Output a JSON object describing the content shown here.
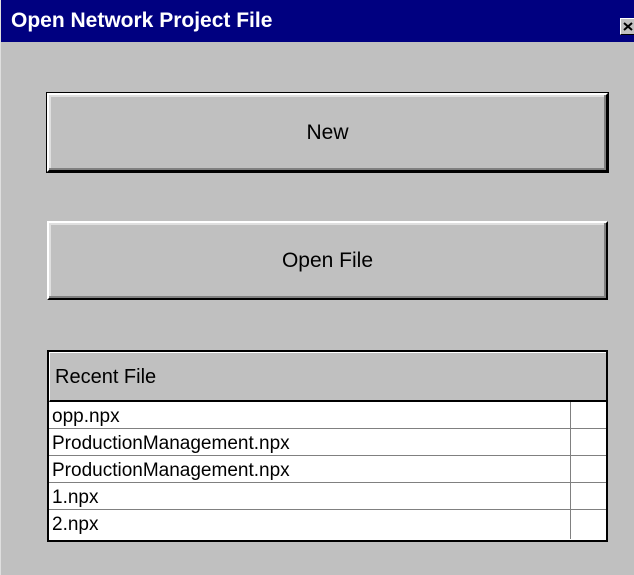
{
  "window": {
    "title": "Open Network Project File",
    "close_icon": "close-icon"
  },
  "buttons": {
    "new_label": "New",
    "open_file_label": "Open File"
  },
  "recent": {
    "header": "Recent File",
    "items": [
      {
        "name": "opp.npx"
      },
      {
        "name": "ProductionManagement.npx"
      },
      {
        "name": "ProductionManagement.npx"
      },
      {
        "name": "1.npx"
      },
      {
        "name": "2.npx"
      }
    ]
  },
  "colors": {
    "titlebar": "#000080",
    "face": "#c0c0c0",
    "list_background": "#ffffff"
  }
}
